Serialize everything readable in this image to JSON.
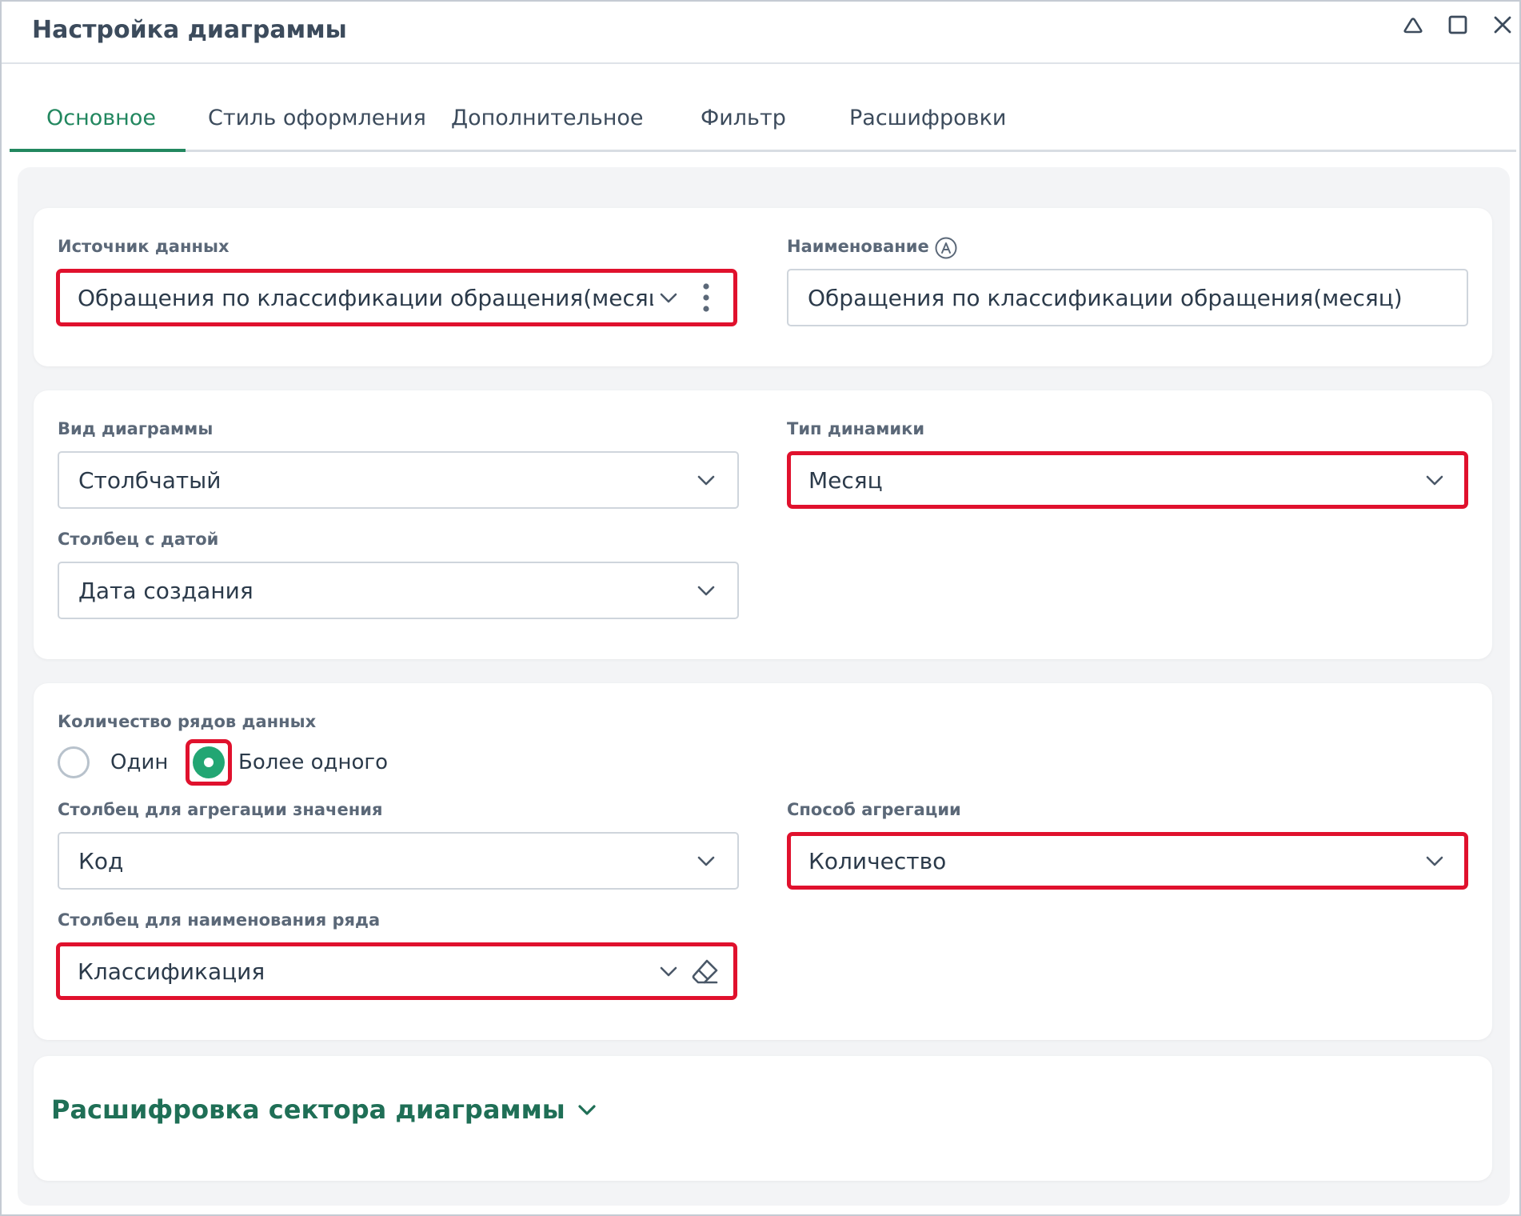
{
  "window": {
    "title": "Настройка диаграммы",
    "controls": [
      "minimize-icon",
      "maximize-icon",
      "close-icon"
    ]
  },
  "tabs": [
    {
      "label": "Основное",
      "active": true
    },
    {
      "label": "Стиль оформления",
      "active": false
    },
    {
      "label": "Дополнительное",
      "active": false
    },
    {
      "label": "Фильтр",
      "active": false
    },
    {
      "label": "Расшифровки",
      "active": false
    }
  ],
  "source_card": {
    "data_source_label": "Источник данных",
    "data_source_value": "Обращения по классификации обращения(месяц)",
    "name_label": "Наименование",
    "name_value": "Обращения по классификации обращения(месяц)"
  },
  "chart_card": {
    "chart_kind_label": "Вид диаграммы",
    "chart_kind_value": "Столбчатый",
    "dynamics_label": "Тип динамики",
    "dynamics_value": "Месяц",
    "date_column_label": "Столбец с датой",
    "date_column_value": "Дата создания"
  },
  "series_card": {
    "series_count_label": "Количество рядов данных",
    "option_one": "Один",
    "option_many": "Более одного",
    "selected": "option_many",
    "agg_column_label": "Столбец для агрегации значения",
    "agg_column_value": "Код",
    "agg_method_label": "Способ агрегации",
    "agg_method_value": "Количество",
    "series_name_label": "Столбец для наименования ряда",
    "series_name_value": "Классификация"
  },
  "drilldown": {
    "label": "Расшифровка сектора диаграммы"
  },
  "colors": {
    "accent": "#22875f",
    "radio_selected": "#22a673",
    "highlight": "#e0112d"
  }
}
